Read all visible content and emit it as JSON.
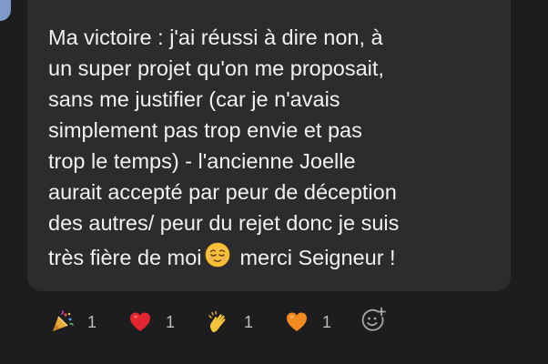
{
  "message": {
    "lines": [
      "Ma victoire : j'ai réussi à dire non, à",
      "un super projet qu'on me proposait,",
      "sans me justifier (car je n'avais",
      "simplement pas trop envie et pas",
      "trop le temps) - l'ancienne Joelle",
      "aurait accepté par peur de déception",
      "des autres/ peur du rejet donc je suis"
    ],
    "last_line_before": "très fière de moi",
    "last_line_after": "merci Seigneur !",
    "inline_emoji": "relieved-face-icon"
  },
  "reactions": [
    {
      "icon": "party-popper-icon",
      "count": "1"
    },
    {
      "icon": "red-heart-icon",
      "count": "1"
    },
    {
      "icon": "clapping-hands-icon",
      "count": "1"
    },
    {
      "icon": "orange-heart-icon",
      "count": "1"
    }
  ],
  "add_reaction_icon": "add-reaction-icon",
  "colors": {
    "background": "#1d1d1f",
    "bubble": "#2c2c2e",
    "text": "#f2f2f2",
    "count": "#bdbdc0",
    "avatar": "#7f99c8"
  }
}
